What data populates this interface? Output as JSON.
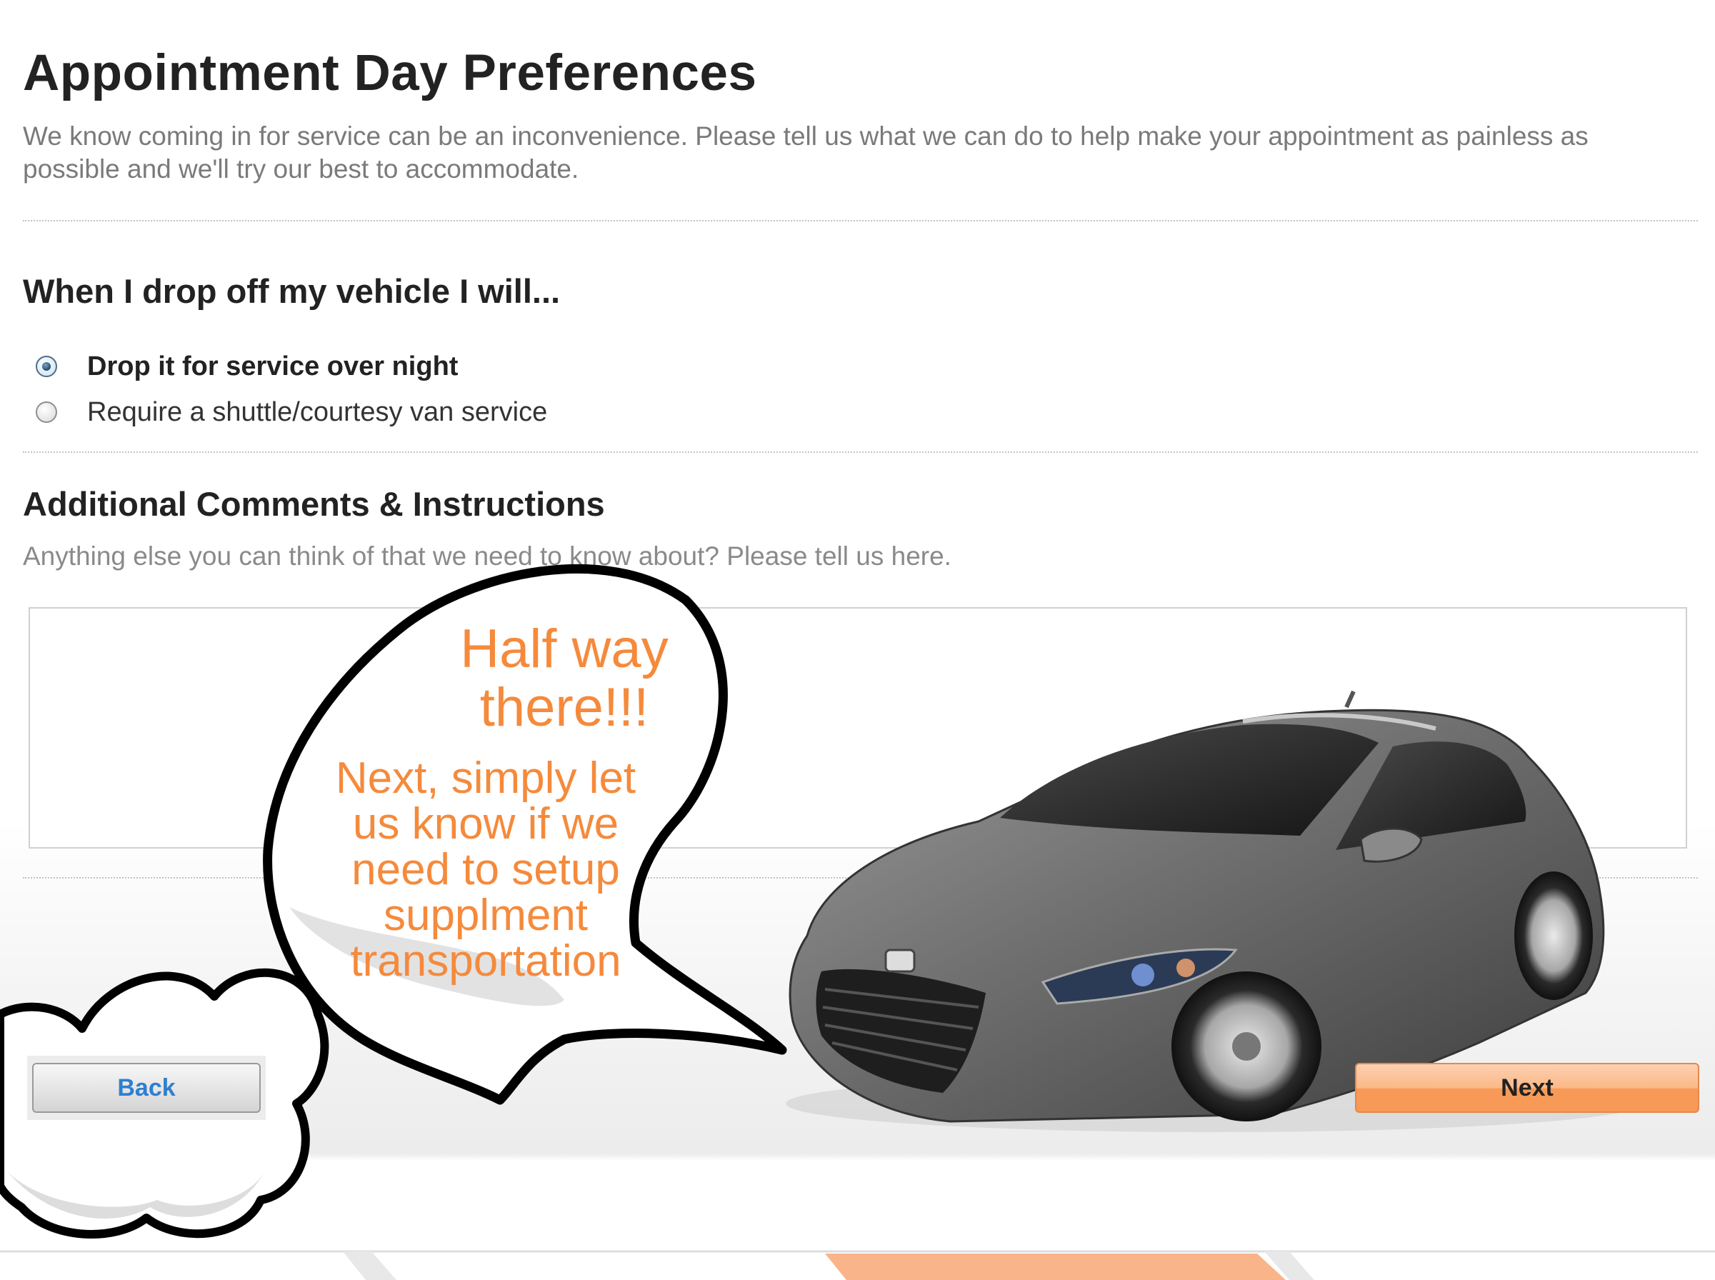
{
  "page": {
    "title": "Appointment Day Preferences",
    "intro": "We know coming in for service can be an inconvenience. Please tell us what we can do to help make your appointment as painless as possible and we'll try our best to accommodate."
  },
  "dropoff": {
    "heading": "When I drop off my vehicle I will...",
    "options": [
      {
        "label": "Drop it for service over night",
        "selected": true
      },
      {
        "label": "Require a shuttle/courtesy van service",
        "selected": false
      }
    ]
  },
  "comments": {
    "heading": "Additional Comments & Instructions",
    "subtext": "Anything else you can think of that we need to know about? Please tell us here.",
    "value": ""
  },
  "bubble": {
    "title": "Half way there!!!",
    "body": "Next, simply let us know if we need to setup supplment transportation"
  },
  "buttons": {
    "back": "Back",
    "next": "Next"
  },
  "colors": {
    "accent": "#f58a3c",
    "next_button": "#f79a58",
    "link_blue": "#2f7fcf"
  }
}
